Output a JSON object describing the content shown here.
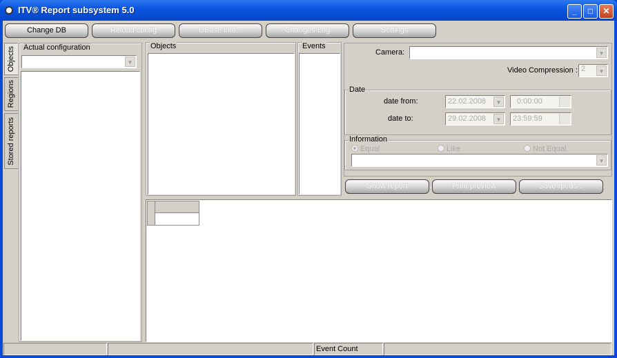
{
  "window": {
    "title": "ITV® Report subsystem 5.0",
    "controls": [
      "_",
      "□",
      "✕"
    ]
  },
  "toolbar": [
    {
      "label": "Change DB",
      "enabled": true
    },
    {
      "label": "Reload config",
      "enabled": false
    },
    {
      "label": "DBase info...",
      "enabled": false
    },
    {
      "label": "Changes Log",
      "enabled": false
    },
    {
      "label": "Settings",
      "enabled": false
    }
  ],
  "side_tabs": [
    "Objects",
    "Regions",
    "Stored reports"
  ],
  "left": {
    "label": "Actual configuration",
    "combo_value": ""
  },
  "objects": {
    "label": "Objects"
  },
  "events": {
    "label": "Events"
  },
  "filters": {
    "camera_label": "Camera:",
    "camera_value": "",
    "compression_label": "Video Compression :",
    "compression_value": "2"
  },
  "date": {
    "label": "Date",
    "from_label": "date from:",
    "from_date": "22.02.2008",
    "from_time": "0:00:00",
    "to_label": "date to:",
    "to_date": "29.02.2008",
    "to_time": "23:59:59"
  },
  "information": {
    "label": "Information",
    "options": [
      "Equal",
      "Like",
      "Not Equal"
    ],
    "selected": "Equal",
    "value": ""
  },
  "actions": [
    "Show report",
    "Print preview",
    "Save rpt as..."
  ],
  "statusbar": {
    "event_count_label": "Event Count"
  }
}
